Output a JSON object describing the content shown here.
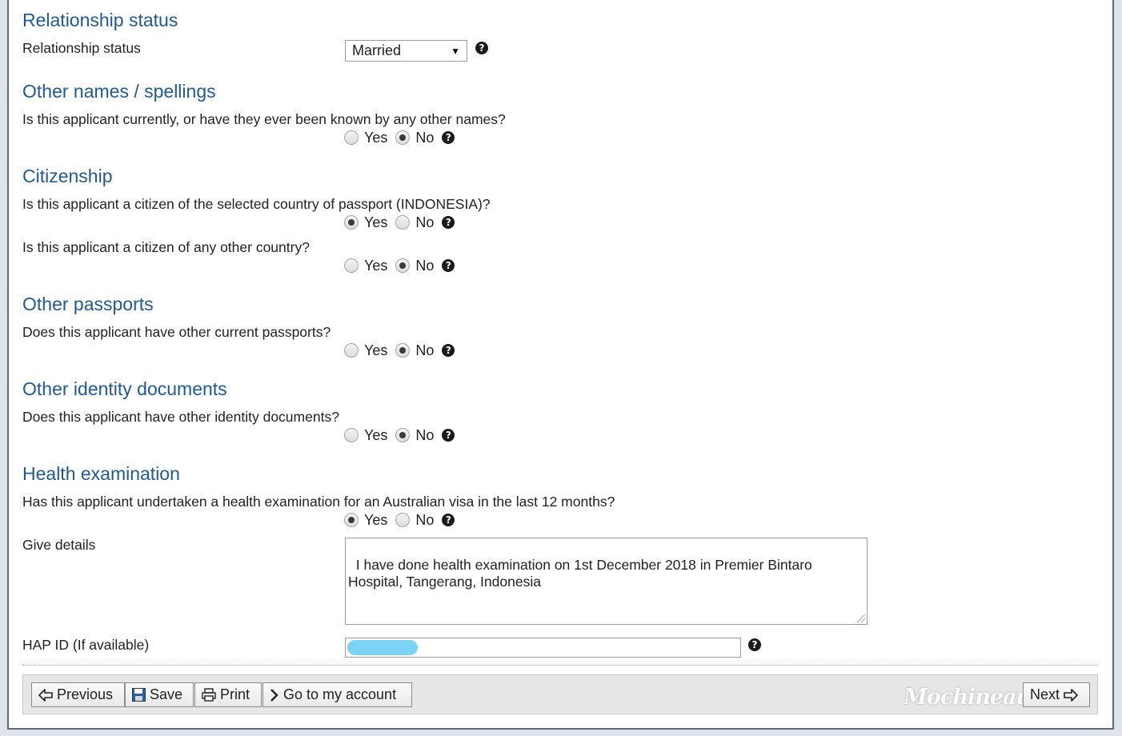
{
  "relationship": {
    "title": "Relationship status",
    "label": "Relationship status",
    "value": "Married",
    "help": "?"
  },
  "other_names": {
    "title": "Other names / spellings",
    "question": "Is this applicant currently, or have they ever been known by any other names?",
    "yes": "Yes",
    "no": "No",
    "selected": "No"
  },
  "citizenship": {
    "title": "Citizenship",
    "q1": "Is this applicant a citizen of the selected country of passport (INDONESIA)?",
    "q1_selected": "Yes",
    "q2": "Is this applicant a citizen of any other country?",
    "q2_selected": "No",
    "yes": "Yes",
    "no": "No"
  },
  "other_passports": {
    "title": "Other passports",
    "question": "Does this applicant have other current passports?",
    "yes": "Yes",
    "no": "No",
    "selected": "No"
  },
  "identity_docs": {
    "title": "Other identity documents",
    "question": "Does this applicant have other identity documents?",
    "yes": "Yes",
    "no": "No",
    "selected": "No"
  },
  "health": {
    "title": "Health examination",
    "question": "Has this applicant undertaken a health examination for an Australian visa in the last 12 months?",
    "yes": "Yes",
    "no": "No",
    "selected": "Yes",
    "details_label": "Give details",
    "details_value": "I have done health examination on 1st December 2018 in Premier Bintaro\nHospital, Tangerang, Indonesia",
    "hap_label": "HAP ID (If available)",
    "hap_value": ""
  },
  "toolbar": {
    "previous": "Previous",
    "save": "Save",
    "print": "Print",
    "account": "Go to my account",
    "next": "Next",
    "watermark": "Mochineau"
  }
}
